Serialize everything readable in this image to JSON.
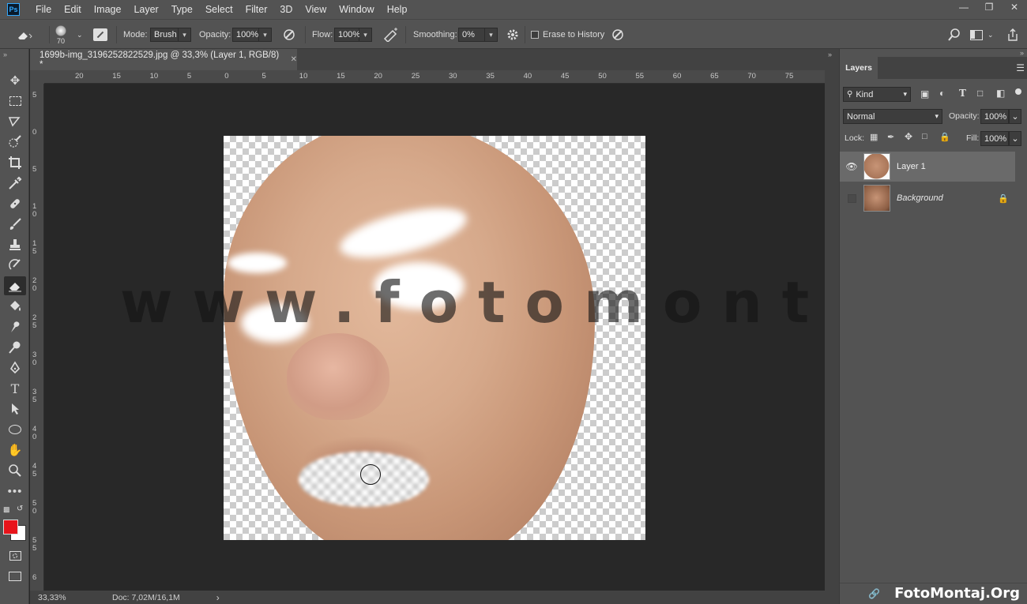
{
  "app": {
    "logo": "Ps"
  },
  "menu": [
    "File",
    "Edit",
    "Image",
    "Layer",
    "Type",
    "Select",
    "Filter",
    "3D",
    "View",
    "Window",
    "Help"
  ],
  "options": {
    "brush_size": "70",
    "mode_label": "Mode:",
    "mode_value": "Brush",
    "opacity_label": "Opacity:",
    "opacity_value": "100%",
    "flow_label": "Flow:",
    "flow_value": "100%",
    "smoothing_label": "Smoothing:",
    "smoothing_value": "0%",
    "erase_history_label": "Erase to History"
  },
  "document": {
    "tab_title": "1699b-img_3196252822529.jpg @ 33,3% (Layer 1, RGB/8) *",
    "watermark": "www.fotomontaj.org",
    "ruler_h": [
      "20",
      "15",
      "10",
      "5",
      "0",
      "5",
      "10",
      "15",
      "20",
      "25",
      "30",
      "35",
      "40",
      "45",
      "50",
      "55",
      "60",
      "65",
      "70",
      "75"
    ],
    "ruler_v": [
      "5",
      "0",
      "5",
      "1 0",
      "1 5",
      "2 0",
      "2 5",
      "3 0",
      "3 5",
      "4 0",
      "4 5",
      "5 0",
      "5 5",
      "6"
    ]
  },
  "status": {
    "zoom": "33,33%",
    "doc": "Doc: 7,02M/16,1M"
  },
  "layers_panel": {
    "title": "Layers",
    "filter_label": "Kind",
    "blend_mode": "Normal",
    "opacity_label": "Opacity:",
    "opacity_value": "100%",
    "lock_label": "Lock:",
    "fill_label": "Fill:",
    "fill_value": "100%",
    "layers": [
      {
        "name": "Layer 1",
        "visible": true,
        "selected": true
      },
      {
        "name": "Background",
        "visible": false,
        "selected": false,
        "locked": true
      }
    ]
  },
  "footer_logo": "FotoMontaj.Org",
  "colors": {
    "foreground": "#e8141b",
    "background": "#ffffff",
    "ps_blue": "#31a8ff"
  }
}
